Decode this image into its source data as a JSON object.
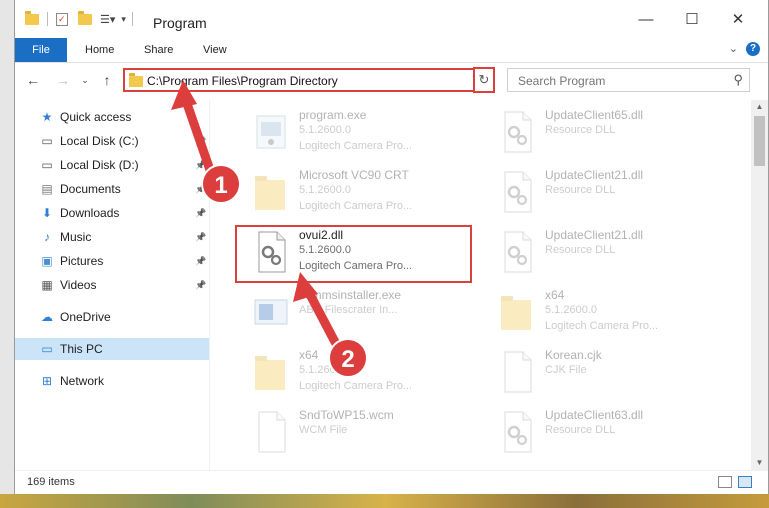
{
  "window": {
    "title": "Program",
    "controls": {
      "minimize": "—",
      "maximize": "☐",
      "close": "✕"
    }
  },
  "ribbon": {
    "tabs": [
      "File",
      "Home",
      "Share",
      "View"
    ],
    "help": "?"
  },
  "navbar": {
    "address": "C:\\Program Files\\Program Directory",
    "search_placeholder": "Search Program"
  },
  "sidebar": {
    "items": [
      {
        "label": "Quick access",
        "icon": "star-icon",
        "pinned": false
      },
      {
        "label": "Local Disk (C:)",
        "icon": "drive-icon",
        "pinned": true
      },
      {
        "label": "Local Disk (D:)",
        "icon": "drive-icon",
        "pinned": true
      },
      {
        "label": "Documents",
        "icon": "documents-icon",
        "pinned": true
      },
      {
        "label": "Downloads",
        "icon": "download-icon",
        "pinned": true
      },
      {
        "label": "Music",
        "icon": "music-icon",
        "pinned": true
      },
      {
        "label": "Pictures",
        "icon": "pictures-icon",
        "pinned": true
      },
      {
        "label": "Videos",
        "icon": "videos-icon",
        "pinned": true
      },
      {
        "label": "OneDrive",
        "icon": "cloud-icon",
        "pinned": false
      },
      {
        "label": "This PC",
        "icon": "computer-icon",
        "pinned": false,
        "selected": true
      },
      {
        "label": "Network",
        "icon": "network-icon",
        "pinned": false
      }
    ]
  },
  "files": [
    {
      "name": "program.exe",
      "line2": "5.1.2600.0",
      "line3": "Logitech Camera Pro...",
      "icon": "exe-icon"
    },
    {
      "name": "UpdateClient65.dll",
      "line2": "Resource DLL",
      "line3": "",
      "icon": "dll-icon"
    },
    {
      "name": "Microsoft VC90 CRT",
      "line2": "5.1.2600.0",
      "line3": "Logitech Camera Pro...",
      "icon": "folder-icon"
    },
    {
      "name": "UpdateClient21.dll",
      "line2": "Resource DLL",
      "line3": "",
      "icon": "dll-icon"
    },
    {
      "name": "ovui2.dll",
      "line2": "5.1.2600.0",
      "line3": "Logitech Camera Pro...",
      "icon": "dll-icon"
    },
    {
      "name": "UpdateClient21.dll",
      "line2": "Resource DLL",
      "line3": "",
      "icon": "dll-icon"
    },
    {
      "name": "commsinstaller.exe",
      "line2": "ABC Filescrater In...",
      "line3": "",
      "icon": "installer-icon"
    },
    {
      "name": "x64",
      "line2": "5.1.2600.0",
      "line3": "Logitech Camera Pro...",
      "icon": "folder-icon"
    },
    {
      "name": "x64",
      "line2": "5.1.2600.0",
      "line3": "Logitech Camera Pro...",
      "icon": "folder-icon"
    },
    {
      "name": "Korean.cjk",
      "line2": "CJK File",
      "line3": "",
      "icon": "file-icon"
    },
    {
      "name": "SndToWP15.wcm",
      "line2": "WCM File",
      "line3": "",
      "icon": "file-icon"
    },
    {
      "name": "UpdateClient63.dll",
      "line2": "Resource DLL",
      "line3": "",
      "icon": "dll-icon"
    }
  ],
  "status": {
    "count": "169 items"
  },
  "annotations": [
    "1",
    "2"
  ],
  "colors": {
    "accent": "#1a6fc5",
    "highlight": "#d9413d",
    "selected": "#cce4f7"
  }
}
